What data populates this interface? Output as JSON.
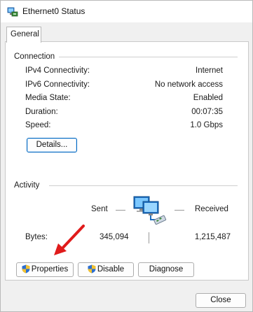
{
  "window": {
    "title": "Ethernet0 Status",
    "title_icon": "network-adapter-icon"
  },
  "tabs": [
    {
      "label": "General",
      "selected": true
    }
  ],
  "connection": {
    "heading": "Connection",
    "rows": [
      {
        "label": "IPv4 Connectivity:",
        "value": "Internet"
      },
      {
        "label": "IPv6 Connectivity:",
        "value": "No network access"
      },
      {
        "label": "Media State:",
        "value": "Enabled"
      },
      {
        "label": "Duration:",
        "value": "00:07:35"
      },
      {
        "label": "Speed:",
        "value": "1.0 Gbps"
      }
    ],
    "details_button": "Details..."
  },
  "activity": {
    "heading": "Activity",
    "sent_label": "Sent",
    "received_label": "Received",
    "bytes_label": "Bytes:",
    "bytes_sent": "345,094",
    "bytes_received": "1,215,487",
    "icon": "network-computers-icon"
  },
  "buttons": {
    "properties": "Properties",
    "disable": "Disable",
    "diagnose": "Diagnose",
    "close": "Close"
  },
  "annotation": {
    "color": "#e01b1b",
    "icon": "red-arrow-icon"
  },
  "colors": {
    "accent": "#0067c0"
  }
}
